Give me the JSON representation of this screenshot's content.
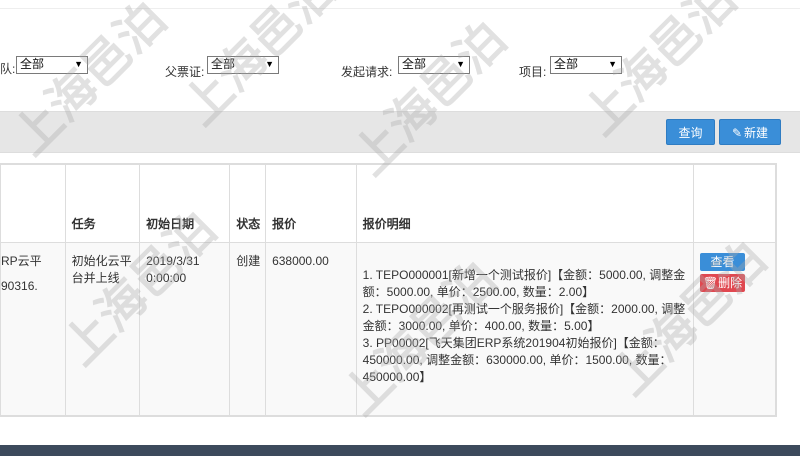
{
  "filters": [
    {
      "label": "队:",
      "value": "全部"
    },
    {
      "label": "父票证:",
      "value": "全部"
    },
    {
      "label": "发起请求:",
      "value": "全部"
    },
    {
      "label": "项目:",
      "value": "全部"
    }
  ],
  "toolbar": {
    "search_label": "查询",
    "new_label": "新建"
  },
  "table": {
    "headers": [
      "",
      "任务",
      "初始日期",
      "状态",
      "报价",
      "报价明细",
      ""
    ],
    "row": {
      "col0": [
        "RP云平",
        "90316."
      ],
      "task": "初始化云平台并上线",
      "date": "2019/3/31 0:00:00",
      "status": "创建",
      "price": "638000.00",
      "details": [
        "1. TEPO000001[新增一个测试报价]【金额：5000.00, 调整金额：5000.00, 单价：2500.00, 数量：2.00】",
        "2. TEPO000002[再测试一个服务报价]【金额：2000.00, 调整金额：3000.00, 单价：400.00, 数量：5.00】",
        "3. PP00002[飞天集团ERP系统201904初始报价]【金额：450000.00, 调整金额：630000.00, 单价：1500.00, 数量：450000.00】"
      ],
      "view_label": "查看",
      "delete_label": "删除"
    }
  },
  "watermark": "上海邑泊",
  "colors": {
    "primary": "#3a8ed8",
    "danger": "#e04850",
    "footer": "#3c4a5c"
  }
}
